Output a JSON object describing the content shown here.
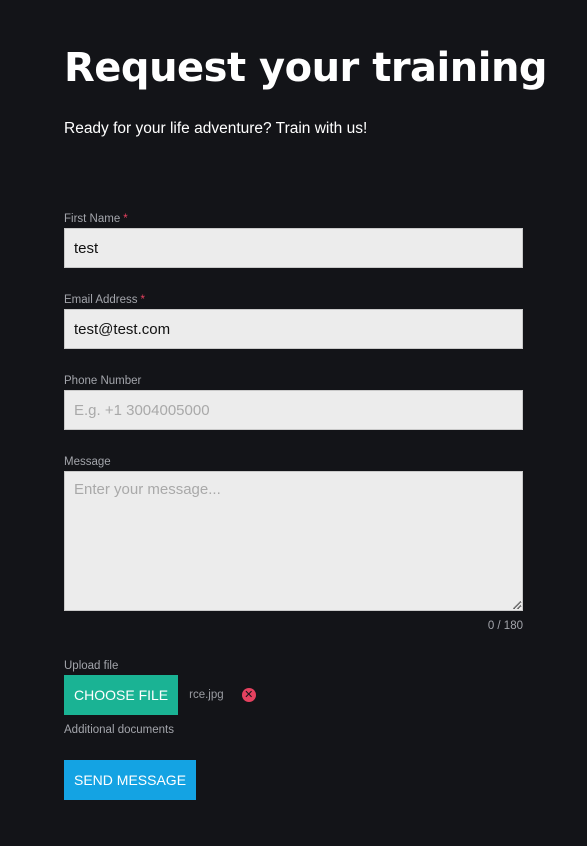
{
  "page": {
    "title": "Request your training",
    "subtitle": "Ready for your life adventure? Train with us!"
  },
  "form": {
    "first_name": {
      "label": "First Name",
      "required_mark": "*",
      "value": "test"
    },
    "email": {
      "label": "Email Address",
      "required_mark": "*",
      "value": "test@test.com"
    },
    "phone": {
      "label": "Phone Number",
      "placeholder": "E.g. +1 3004005000",
      "value": ""
    },
    "message": {
      "label": "Message",
      "placeholder": "Enter your message...",
      "value": "",
      "counter": "0 / 180"
    },
    "upload": {
      "label": "Upload file",
      "button_label": "CHOOSE FILE",
      "file_name": "rce.jpg",
      "remove_icon": "close-circle-icon",
      "help": "Additional documents"
    },
    "submit_label": "SEND MESSAGE"
  },
  "colors": {
    "background": "#131418",
    "choose_button": "#1ab394",
    "send_button": "#14a3e3",
    "required": "#e5415f"
  }
}
